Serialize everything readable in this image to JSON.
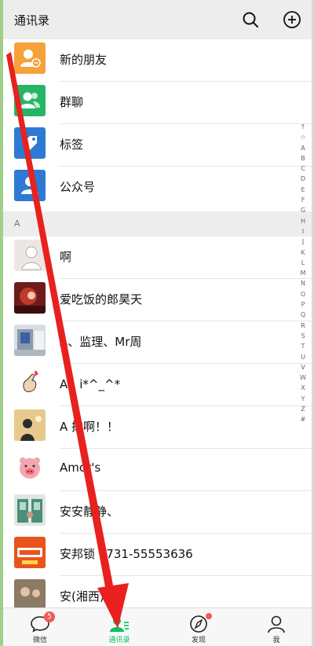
{
  "header": {
    "title": "通讯录"
  },
  "special_items": [
    {
      "label": "新的朋友",
      "color": "#f6a13a",
      "icon": "add-friend-icon"
    },
    {
      "label": "群聊",
      "color": "#26b565",
      "icon": "group-chat-icon"
    },
    {
      "label": "标签",
      "color": "#2d79d5",
      "icon": "tag-icon"
    },
    {
      "label": "公众号",
      "color": "#2d79d5",
      "icon": "official-account-icon"
    }
  ],
  "section_header": "A",
  "contacts": [
    {
      "name": "啊"
    },
    {
      "name": "爱吃饭的郎昊天"
    },
    {
      "name": "A、监理、Mr周"
    },
    {
      "name": "A、i*^_^*"
    },
    {
      "name": "A  拨啊！！"
    },
    {
      "name": "Amor's"
    },
    {
      "name": "安安静静、"
    },
    {
      "name": "安邦锁 0731-55553636"
    },
    {
      "name": "安(湘西)搬"
    }
  ],
  "index_letters": [
    "↑",
    "☆",
    "A",
    "B",
    "C",
    "D",
    "E",
    "F",
    "G",
    "H",
    "I",
    "J",
    "K",
    "L",
    "M",
    "N",
    "O",
    "P",
    "Q",
    "R",
    "S",
    "T",
    "U",
    "V",
    "W",
    "X",
    "Y",
    "Z",
    "#"
  ],
  "tabbar": {
    "chats": {
      "label": "微信",
      "badge": "5"
    },
    "contacts": {
      "label": "通讯录"
    },
    "discover": {
      "label": "发现"
    },
    "me": {
      "label": "我"
    }
  },
  "colors": {
    "accent": "#07c160",
    "annotation": "#e8211e",
    "badge": "#f05a5a"
  }
}
